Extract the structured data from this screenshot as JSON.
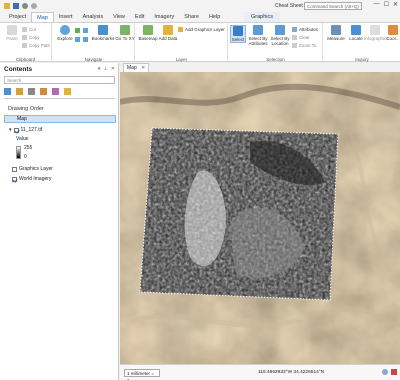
{
  "window": {
    "doc_title": "Cheat Sheet",
    "command_search_placeholder": "Command Search (Alt+Q)",
    "minimize": "—",
    "maximize": "☐",
    "close": "✕"
  },
  "ribbon_tabs": [
    "Project",
    "Map",
    "Insert",
    "Analysis",
    "View",
    "Edit",
    "Imagery",
    "Share",
    "Help"
  ],
  "context_tab": "Graphics",
  "ribbon": {
    "clipboard": {
      "label": "Clipboard",
      "paste": "Paste",
      "cut": "Cut",
      "copy": "Copy",
      "copy_path": "Copy Path"
    },
    "navigate": {
      "label": "Navigate",
      "explore": "Explore",
      "bookmarks": "Bookmarks",
      "go_to_xy": "Go To XY"
    },
    "layer": {
      "label": "Layer",
      "basemap": "Basemap",
      "add_data": "Add Data",
      "add_graphics_layer": "Add Graphics Layer"
    },
    "selection": {
      "label": "Selection",
      "select": "Select",
      "select_by_attributes": "Select By Attributes",
      "select_by_location": "Select By Location",
      "attributes": "Attributes",
      "clear": "Clear",
      "zoom_to": "Zoom To"
    },
    "inquiry": {
      "label": "Inquiry",
      "measure": "Measure",
      "locate": "Locate",
      "infographics": "Infographics",
      "coordinate_conversion": "Coor..."
    }
  },
  "contents": {
    "title": "Contents",
    "search_placeholder": "Search",
    "drawing_order": "Drawing Order",
    "map": "Map",
    "raster_layer": "11_127.tif",
    "value_label": "Value",
    "value_high": "255",
    "value_low": "0",
    "graphics_layer": "Graphics Layer",
    "world_imagery": "World Imagery"
  },
  "map_tab": "Map",
  "status": {
    "scale": "1 millimeter = 1...",
    "coordinates": "116.4862933°W 34.4225514°N"
  },
  "colors": {
    "accent": "#1a5fa8",
    "selection": "#cfe3f7"
  }
}
